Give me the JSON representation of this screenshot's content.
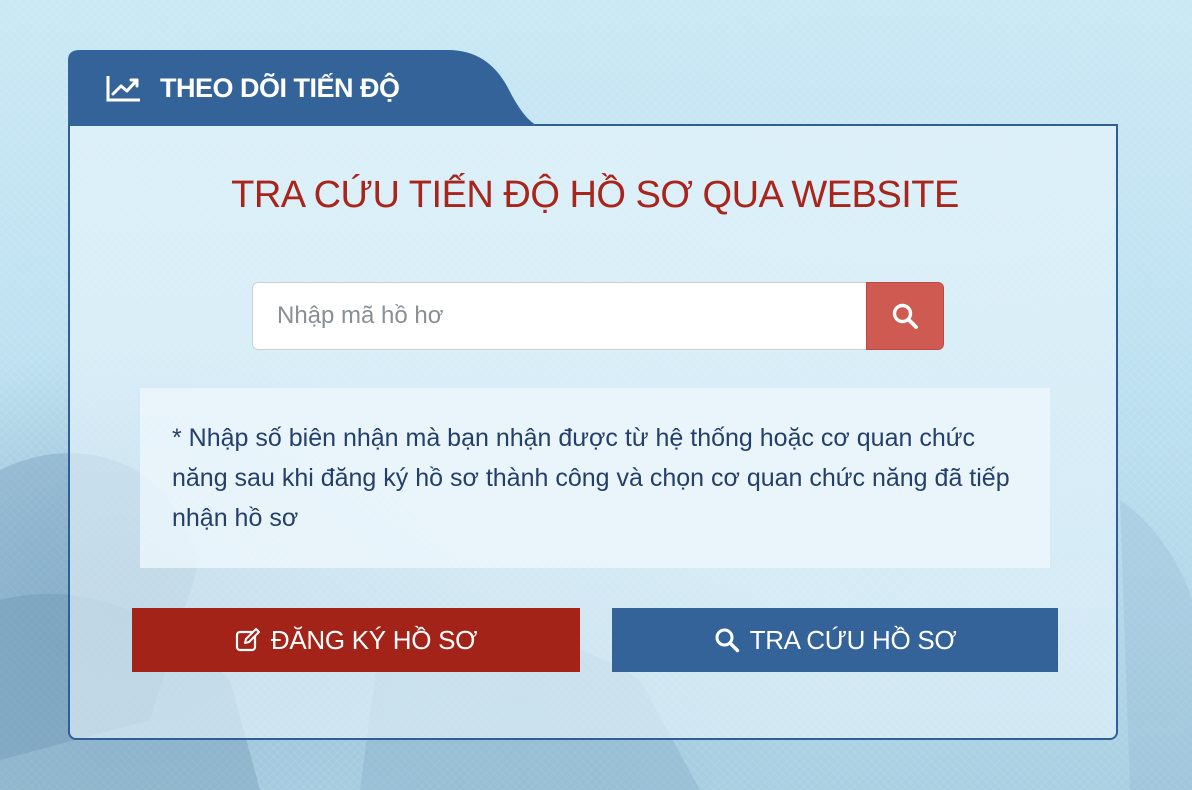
{
  "tab": {
    "title": "THEO DÕI TIẾN ĐỘ",
    "icon": "line-chart-icon"
  },
  "main": {
    "heading": "TRA CỨU TIẾN ĐỘ HỒ SƠ QUA WEBSITE",
    "search": {
      "placeholder": "Nhập mã hồ hơ",
      "value": "",
      "button_icon": "search-icon"
    },
    "note": "* Nhập số biên nhận mà bạn nhận được từ hệ thống hoặc cơ quan chức năng sau khi đăng ký hồ sơ thành công và chọn cơ quan chức năng đã tiếp nhận hồ sơ"
  },
  "actions": {
    "register": {
      "label": "ĐĂNG KÝ HỒ SƠ",
      "icon": "edit-icon"
    },
    "lookup": {
      "label": "TRA CỨU HỒ SƠ",
      "icon": "search-icon"
    }
  },
  "colors": {
    "tab_blue": "#336399",
    "heading_red": "#a9241a",
    "search_button": "#cf5a52",
    "register_button": "#a32318",
    "lookup_button": "#336399",
    "note_text": "#243f6a"
  }
}
